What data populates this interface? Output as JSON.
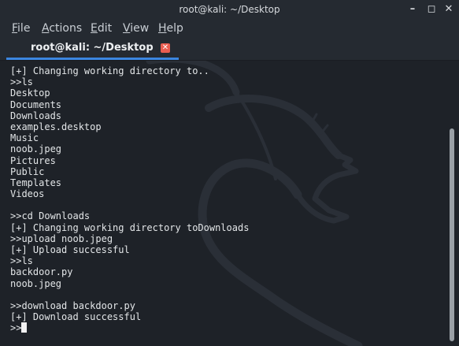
{
  "window": {
    "title": "root@kali: ~/Desktop",
    "minimize_glyph": "–",
    "maximize_glyph": "◻",
    "close_glyph": "✕"
  },
  "menu": {
    "file": {
      "mnemonic": "F",
      "rest": "ile"
    },
    "actions": {
      "mnemonic": "A",
      "rest": "ctions"
    },
    "edit": {
      "mnemonic": "E",
      "rest": "dit"
    },
    "view": {
      "mnemonic": "V",
      "rest": "iew"
    },
    "help": {
      "mnemonic": "H",
      "rest": "elp"
    }
  },
  "tab": {
    "label": "root@kali: ~/Desktop",
    "close_glyph": "✕",
    "accent_color": "#3b86e0",
    "close_color": "#ea5d50"
  },
  "terminal": {
    "lines": [
      "[+] Changing working directory to..",
      ">>ls",
      "Desktop",
      "Documents",
      "Downloads",
      "examples.desktop",
      "Music",
      "noob.jpeg",
      "Pictures",
      "Public",
      "Templates",
      "Videos",
      "",
      ">>cd Downloads",
      "[+] Changing working directory toDownloads",
      ">>upload noob.jpeg",
      "[+] Upload successful",
      ">>ls",
      "backdoor.py",
      "noob.jpeg",
      "",
      ">>download backdoor.py",
      "[+] Download successful"
    ],
    "prompt": ">>",
    "background_icon": "kali-dragon-icon"
  }
}
